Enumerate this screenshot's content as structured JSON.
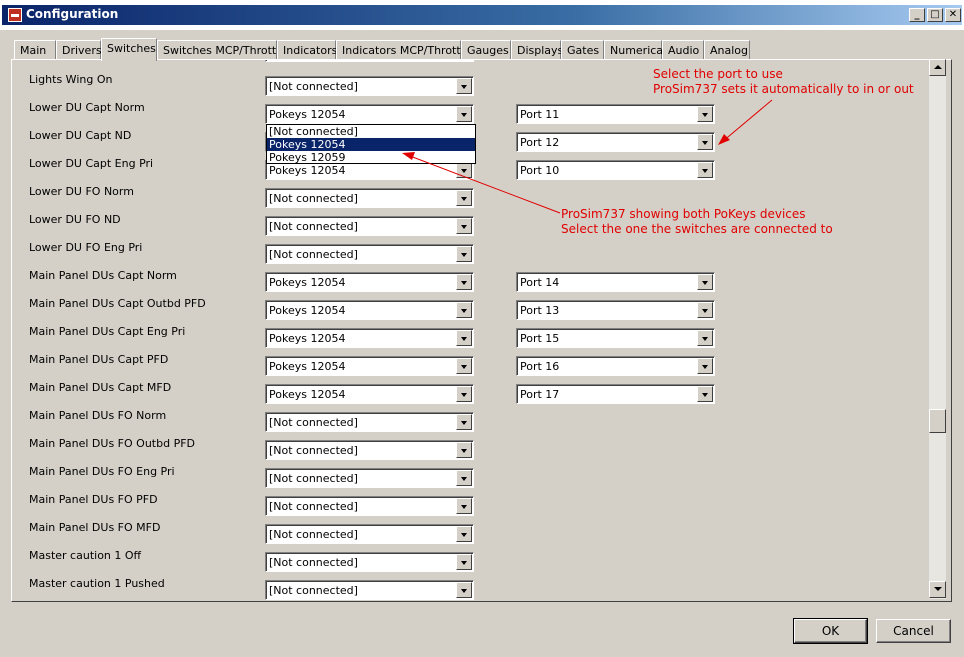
{
  "window": {
    "title": "Configuration"
  },
  "tabs": [
    {
      "label": "Main"
    },
    {
      "label": "Drivers"
    },
    {
      "label": "Switches"
    },
    {
      "label": "Switches MCP/Throttle"
    },
    {
      "label": "Indicators"
    },
    {
      "label": "Indicators MCP/Throttle"
    },
    {
      "label": "Gauges"
    },
    {
      "label": "Displays"
    },
    {
      "label": "Gates"
    },
    {
      "label": "Numerical"
    },
    {
      "label": "Audio"
    },
    {
      "label": "Analog"
    }
  ],
  "rows": [
    {
      "label": "",
      "device": "[Not connected]",
      "port": ""
    },
    {
      "label": "Lights Wing On",
      "device": "[Not connected]",
      "port": ""
    },
    {
      "label": "Lower DU Capt Norm",
      "device": "Pokeys 12054",
      "port": "Port 11"
    },
    {
      "label": "Lower DU Capt ND",
      "device": "Pokeys 12054",
      "port": "Port 12"
    },
    {
      "label": "Lower DU Capt Eng Pri",
      "device": "Pokeys 12054",
      "port": "Port 10"
    },
    {
      "label": "Lower DU FO Norm",
      "device": "[Not connected]",
      "port": ""
    },
    {
      "label": "Lower DU FO ND",
      "device": "[Not connected]",
      "port": ""
    },
    {
      "label": "Lower DU FO Eng Pri",
      "device": "[Not connected]",
      "port": ""
    },
    {
      "label": "Main Panel DUs Capt Norm",
      "device": "Pokeys 12054",
      "port": "Port 14"
    },
    {
      "label": "Main Panel DUs Capt Outbd PFD",
      "device": "Pokeys 12054",
      "port": "Port 13"
    },
    {
      "label": "Main Panel DUs Capt Eng Pri",
      "device": "Pokeys 12054",
      "port": "Port 15"
    },
    {
      "label": "Main Panel DUs Capt PFD",
      "device": "Pokeys 12054",
      "port": "Port 16"
    },
    {
      "label": "Main Panel DUs Capt MFD",
      "device": "Pokeys 12054",
      "port": "Port 17"
    },
    {
      "label": "Main Panel DUs FO Norm",
      "device": "[Not connected]",
      "port": ""
    },
    {
      "label": "Main Panel DUs FO Outbd PFD",
      "device": "[Not connected]",
      "port": ""
    },
    {
      "label": "Main Panel DUs FO Eng Pri",
      "device": "[Not connected]",
      "port": ""
    },
    {
      "label": "Main Panel DUs FO PFD",
      "device": "[Not connected]",
      "port": ""
    },
    {
      "label": "Main Panel DUs FO MFD",
      "device": "[Not connected]",
      "port": ""
    },
    {
      "label": "Master caution 1 Off",
      "device": "[Not connected]",
      "port": ""
    },
    {
      "label": "Master caution 1 Pushed",
      "device": "[Not connected]",
      "port": ""
    }
  ],
  "dropdown_open": {
    "options": [
      "[Not connected]",
      "Pokeys 12054",
      "Pokeys 12059"
    ],
    "selected_index": 1
  },
  "annotations": {
    "port_note_line1": "Select the port to use",
    "port_note_line2": "ProSim737 sets it automatically to in or out",
    "device_note_line1": "ProSim737 showing both PoKeys devices",
    "device_note_line2": "Select the one the switches are connected to",
    "color": "#e00000"
  },
  "buttons": {
    "ok": "OK",
    "cancel": "Cancel"
  }
}
